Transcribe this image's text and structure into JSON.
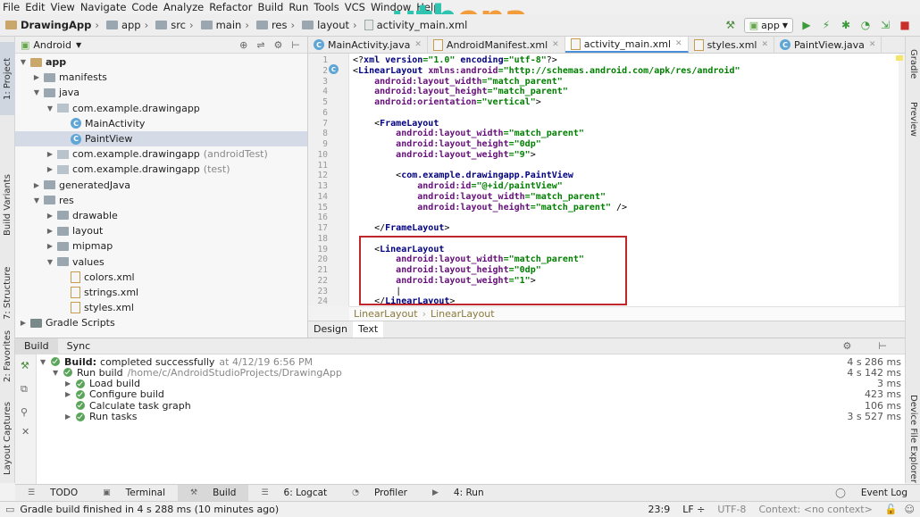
{
  "menu": [
    "File",
    "Edit",
    "View",
    "Navigate",
    "Code",
    "Analyze",
    "Refactor",
    "Build",
    "Run",
    "Tools",
    "VCS",
    "Window",
    "Help"
  ],
  "logo": {
    "part1": "uth",
    "part2": "ena"
  },
  "nav": {
    "crumbs": [
      "DrawingApp",
      "app",
      "src",
      "main",
      "res",
      "layout",
      "activity_main.xml"
    ],
    "run_config": "app"
  },
  "left_tabs": [
    "1: Project",
    "Build Variants",
    "7: Structure",
    "2: Favorites",
    "Layout Captures"
  ],
  "right_tabs": [
    "Gradle",
    "Preview",
    "Device File Explorer"
  ],
  "project": {
    "view": "Android",
    "tree": [
      {
        "label": "app",
        "level": 0,
        "icon": "folder",
        "open": true,
        "bold": true
      },
      {
        "label": "manifests",
        "level": 1,
        "icon": "folder",
        "open": false
      },
      {
        "label": "java",
        "level": 1,
        "icon": "folder",
        "open": true
      },
      {
        "label": "com.example.drawingapp",
        "level": 2,
        "icon": "package",
        "open": true
      },
      {
        "label": "MainActivity",
        "level": 3,
        "icon": "class"
      },
      {
        "label": "PaintView",
        "level": 3,
        "icon": "class",
        "selected": true
      },
      {
        "label": "com.example.drawingapp",
        "suffix": "(androidTest)",
        "level": 2,
        "icon": "package",
        "open": false
      },
      {
        "label": "com.example.drawingapp",
        "suffix": "(test)",
        "level": 2,
        "icon": "package",
        "open": false
      },
      {
        "label": "generatedJava",
        "level": 1,
        "icon": "folder",
        "open": false
      },
      {
        "label": "res",
        "level": 1,
        "icon": "folder",
        "open": true
      },
      {
        "label": "drawable",
        "level": 2,
        "icon": "folder",
        "open": false
      },
      {
        "label": "layout",
        "level": 2,
        "icon": "folder",
        "open": false
      },
      {
        "label": "mipmap",
        "level": 2,
        "icon": "folder",
        "open": false
      },
      {
        "label": "values",
        "level": 2,
        "icon": "folder",
        "open": true
      },
      {
        "label": "colors.xml",
        "level": 3,
        "icon": "xml"
      },
      {
        "label": "strings.xml",
        "level": 3,
        "icon": "xml"
      },
      {
        "label": "styles.xml",
        "level": 3,
        "icon": "xml"
      },
      {
        "label": "Gradle Scripts",
        "level": 0,
        "icon": "gradle",
        "open": false
      }
    ]
  },
  "editor_tabs": [
    {
      "label": "MainActivity.java",
      "icon": "class"
    },
    {
      "label": "AndroidManifest.xml",
      "icon": "xml"
    },
    {
      "label": "activity_main.xml",
      "icon": "xml",
      "active": true
    },
    {
      "label": "styles.xml",
      "icon": "xml"
    },
    {
      "label": "PaintView.java",
      "icon": "class"
    }
  ],
  "code_lines": [
    {
      "n": "1",
      "html": "<span class='plain'>&lt;?</span><span class='tag'>xml version</span><span class='val'>=\"1.0\"</span><span class='tag'> encoding</span><span class='val'>=\"utf-8\"</span><span class='plain'>?&gt;</span>"
    },
    {
      "n": "2",
      "html": "<span class='plain'>&lt;</span><span class='tag'>LinearLayout </span><span class='attr'>xmlns:android</span><span class='val'>=\"http://schemas.android.com/apk/res/android\"</span>"
    },
    {
      "n": "3",
      "html": "    <span class='attr'>android:layout_width</span><span class='val'>=\"match_parent\"</span>"
    },
    {
      "n": "4",
      "html": "    <span class='attr'>android:layout_height</span><span class='val'>=\"match_parent\"</span>"
    },
    {
      "n": "5",
      "html": "    <span class='attr'>android:orientation</span><span class='val'>=\"vertical\"</span><span class='plain'>&gt;</span>"
    },
    {
      "n": "6",
      "html": ""
    },
    {
      "n": "7",
      "html": "    <span class='plain'>&lt;</span><span class='tag'>FrameLayout</span>"
    },
    {
      "n": "8",
      "html": "        <span class='attr'>android:layout_width</span><span class='val'>=\"match_parent\"</span>"
    },
    {
      "n": "9",
      "html": "        <span class='attr'>android:layout_height</span><span class='val'>=\"0dp\"</span>"
    },
    {
      "n": "10",
      "html": "        <span class='attr'>android:layout_weight</span><span class='val'>=\"9\"</span><span class='plain'>&gt;</span>"
    },
    {
      "n": "11",
      "html": ""
    },
    {
      "n": "12",
      "html": "        <span class='plain'>&lt;</span><span class='tag'>com.example.drawingapp.PaintView</span>"
    },
    {
      "n": "13",
      "html": "            <span class='attr'>android:id</span><span class='val'>=\"@+id/paintView\"</span>"
    },
    {
      "n": "14",
      "html": "            <span class='attr'>android:layout_width</span><span class='val'>=\"match_parent\"</span>"
    },
    {
      "n": "15",
      "html": "            <span class='attr'>android:layout_height</span><span class='val'>=\"match_parent\"</span><span class='plain'> /&gt;</span>"
    },
    {
      "n": "16",
      "html": ""
    },
    {
      "n": "17",
      "html": "    <span class='plain'>&lt;/</span><span class='tag'>FrameLayout</span><span class='plain'>&gt;</span>"
    },
    {
      "n": "18",
      "html": ""
    },
    {
      "n": "19",
      "html": "    <span class='plain'>&lt;</span><span class='tag'>LinearLayout</span>"
    },
    {
      "n": "20",
      "html": "        <span class='attr'>android:layout_width</span><span class='val'>=\"match_parent\"</span>"
    },
    {
      "n": "21",
      "html": "        <span class='attr'>android:layout_height</span><span class='val'>=\"0dp\"</span>"
    },
    {
      "n": "22",
      "html": "        <span class='attr'>android:layout_weight</span><span class='val'>=\"1\"</span><span class='plain'>&gt;</span>"
    },
    {
      "n": "23",
      "html": "        <span class='plain'>|</span>"
    },
    {
      "n": "24",
      "html": "    <span class='plain'>&lt;/</span><span class='tag'>LinearLayout</span><span class='plain'>&gt;</span>"
    }
  ],
  "code_breadcrumb": [
    "LinearLayout",
    "LinearLayout"
  ],
  "design_tabs": [
    "Design",
    "Text"
  ],
  "build_tabs": [
    "Build",
    "Sync"
  ],
  "build_rows": [
    {
      "label": "Build:",
      "detail": "completed successfully",
      "extra": "at 4/12/19 6:56 PM",
      "time": "4 s 286 ms",
      "level": 0,
      "arrow": "▼",
      "bold": true
    },
    {
      "label": "Run build",
      "detail": "",
      "extra": "/home/c/AndroidStudioProjects/DrawingApp",
      "time": "4 s 142 ms",
      "level": 1,
      "arrow": "▼"
    },
    {
      "label": "Load build",
      "detail": "",
      "extra": "",
      "time": "3 ms",
      "level": 2,
      "arrow": "▶"
    },
    {
      "label": "Configure build",
      "detail": "",
      "extra": "",
      "time": "423 ms",
      "level": 2,
      "arrow": "▶"
    },
    {
      "label": "Calculate task graph",
      "detail": "",
      "extra": "",
      "time": "106 ms",
      "level": 2,
      "arrow": ""
    },
    {
      "label": "Run tasks",
      "detail": "",
      "extra": "",
      "time": "3 s 527 ms",
      "level": 2,
      "arrow": "▶"
    }
  ],
  "tool_tabs": [
    {
      "label": "TODO",
      "icon": "☰"
    },
    {
      "label": "Terminal",
      "icon": "▣"
    },
    {
      "label": "Build",
      "icon": "⚒",
      "active": true
    },
    {
      "label": "6: Logcat",
      "icon": "☰"
    },
    {
      "label": "Profiler",
      "icon": "◔"
    },
    {
      "label": "4: Run",
      "icon": "▶"
    }
  ],
  "event_log": "Event Log",
  "status": {
    "message": "Gradle build finished in 4 s 288 ms (10 minutes ago)",
    "position": "23:9",
    "line_sep": "LF ÷",
    "encoding": "UTF-8",
    "context": "Context: <no context>"
  }
}
